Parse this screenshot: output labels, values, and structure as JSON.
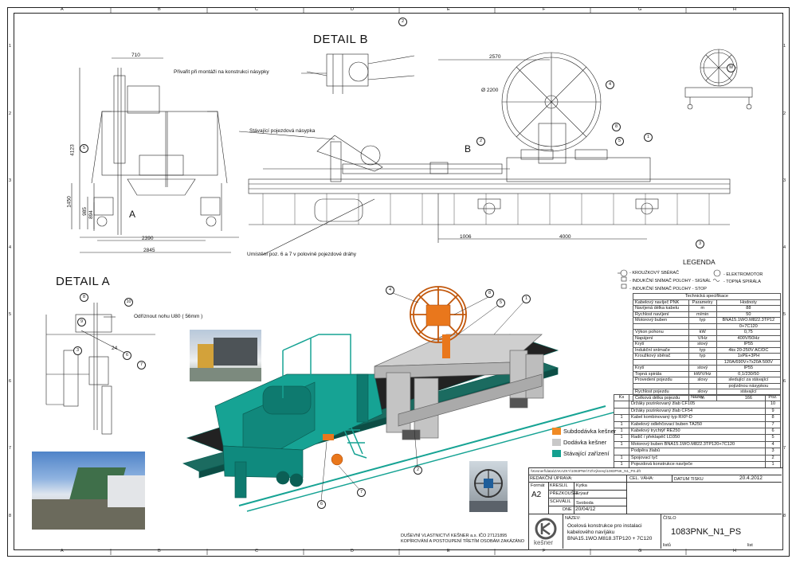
{
  "grid": {
    "columns": [
      "A",
      "B",
      "C",
      "D",
      "E",
      "F",
      "G",
      "H"
    ],
    "rows": [
      "1",
      "2",
      "3",
      "4",
      "5",
      "6",
      "7",
      "8"
    ]
  },
  "details": {
    "detail_b": "DETAIL B",
    "detail_a": "DETAIL A",
    "marker_a": "A",
    "marker_b": "B"
  },
  "dimensions": {
    "d710": "710",
    "d4123": "4123",
    "d1450": "1450",
    "d985": "985",
    "d894": "894",
    "d2390": "2390",
    "d2845": "2845",
    "d2570": "2570",
    "d2200": "Ø 2200",
    "d1006": "1006",
    "d4000": "4000",
    "d24": "24"
  },
  "notes": {
    "privarit": "Přivařit při montáži na konstrukci násypky",
    "stavajici": "Stávající pojezdová násypka",
    "umisteni": "Umístění poz. 6 a 7 v polovině pojezdové dráhy",
    "odriznout": "Odříznout nohu U80 ( 56mm )"
  },
  "legenda": {
    "title": "LEGENDA",
    "left": [
      "- KROUŽKOVÝ SBĚRAČ",
      "- INDUKČNÍ SNÍMAČ POLOHY - SIGNÁL",
      "- INDUKČNÍ SNÍMAČ POLOHY - STOP"
    ],
    "right": [
      "- ELEKTROMOTOR",
      "- TOPNÁ SPIRÁLA"
    ],
    "m_symbol": "M"
  },
  "spec": {
    "title": "Technická specifikace",
    "rows": [
      [
        "Kabelový navíječ PNK",
        "Parametry",
        "Hodnoty"
      ],
      [
        "Navíjená délka kabelu",
        "m",
        "88"
      ],
      [
        "Rychlost navíjení",
        "m/min",
        "50"
      ],
      [
        "Motorový buben",
        "typ",
        "BNA15.1WO.M822.3TP12"
      ],
      [
        "",
        "",
        "0+7C120"
      ],
      [
        "Výkon pohonu",
        "kW",
        "0,75"
      ],
      [
        "Napájení",
        "V/Hz",
        "400V/50Hz"
      ],
      [
        "Krytí",
        "stový",
        "IP55"
      ],
      [
        "Indukční snímače",
        "typ",
        "4ks 20-250V AC/DC"
      ],
      [
        "Kroužkový sběrač",
        "typ",
        "1xPE+3PH"
      ],
      [
        "",
        "",
        "120A/690V+7x20A 500V"
      ],
      [
        "Krytí",
        "stový",
        "IP55"
      ],
      [
        "Topná spirála",
        "kW/V/Hz",
        "0,1/230/50"
      ],
      [
        "Provedení pojezdu",
        "slovy",
        "sledující za stávající"
      ],
      [
        "",
        "",
        "pojízdnou násypkou"
      ],
      [
        "Rychlost pojezdu",
        "slovy",
        "stávající"
      ],
      [
        "Celková délka pojezdu",
        "m",
        "166"
      ]
    ]
  },
  "parts": {
    "header": [
      "Ks",
      "Název",
      "Poz."
    ],
    "rows": [
      [
        "",
        "Držáky pozinkovaný žlab CF105",
        "10"
      ],
      [
        "",
        "Držáky pozinkovaný žlab CF54",
        "9"
      ],
      [
        "1",
        "Kabel kombinovaný typ RXP-D",
        "8"
      ],
      [
        "1",
        "Kabelový odlehčovací buben TA250",
        "7"
      ],
      [
        "1",
        "Kabelový trychtýř RE250",
        "6"
      ],
      [
        "1",
        "Radič / překlapěč LD350",
        "5"
      ],
      [
        "1",
        "Motorový buben BNA15.1WO.M822.3TP120+7C120",
        "4"
      ],
      [
        "",
        "Podpěra žlabů",
        "3"
      ],
      [
        "1",
        "Spojovací tyč",
        "2"
      ],
      [
        "1",
        "Pojezdová konstrukce navíječe",
        "1"
      ]
    ]
  },
  "legend_colors": [
    {
      "label": "Subdodávka kešner",
      "color": "#f08a24"
    },
    {
      "label": "Dodávka kešner",
      "color": "#c8c8c8"
    },
    {
      "label": "Stávající zařízení",
      "color": "#14a090"
    }
  ],
  "title_block": {
    "path": "\\\\Kesnerf\\data\\ZAKAZKY\\1083PNK\\TZ\\Výkresy\\1083PNK_N1_PS.dft",
    "redakce": "REDAKČNÍ ÚPRAVA:",
    "cel_vaha_label": "CEL. VÁHA:",
    "datum_tisku_label": "DATUM TISKU",
    "datum_tisku": "20.4.2012",
    "format_label": "Formát",
    "format": "A2",
    "kreslil_label": "KRESLIL",
    "kreslil": "Kytka",
    "prezkousel_label": "PŘEZKOUŠEL",
    "prezkousel": "Frýauf",
    "schvalil_label": "SCHVÁLIL",
    "schvalil": "Svoboda",
    "dne_label": "DNE",
    "dne": "20/04/12",
    "nazev_label": "NÁZEV:",
    "nazev": [
      "Ocelová konstrukce pro instalaci",
      "kabelového navíjáku",
      "BNA15.1WO.M818.3TP120 + 7C120"
    ],
    "cislo_label": "ČÍSLO",
    "cislo": "1083PNK_N1_PS",
    "listu_label": "listů",
    "list_label": "list",
    "logo": "kešner",
    "copyright": [
      "DUŠEVNÍ VLASTNICTVÍ KEŠNER a.s. IČO 27121895",
      "KOPÍROVÁNÍ A POSTOUPENÍ TŘETÍM OSOBÁM ZAKÁZÁNO"
    ]
  }
}
